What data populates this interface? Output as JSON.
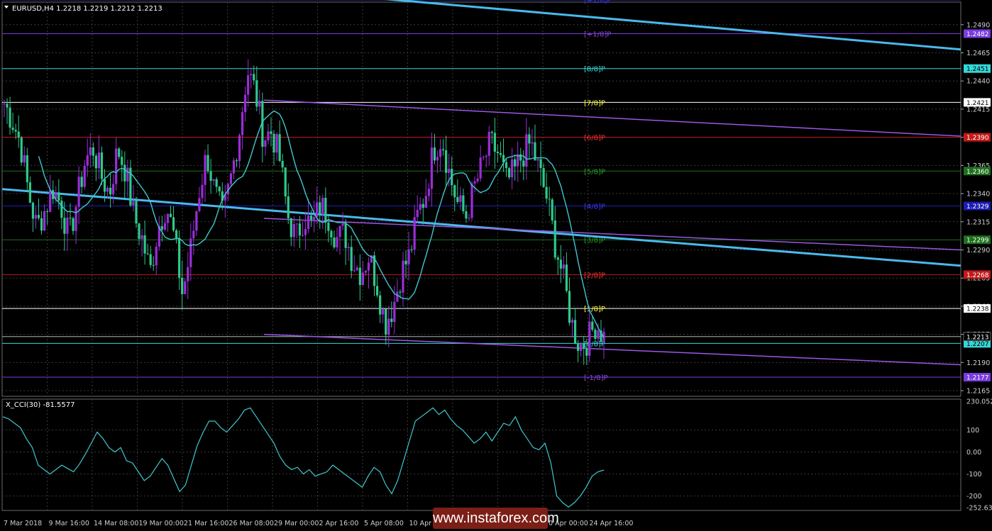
{
  "header": {
    "symbol_line": "EURUSD,H4  1.2218 1.2219 1.2212 1.2213"
  },
  "colors": {
    "bull": "#9a2dd8",
    "bear": "#2ec98a",
    "ma": "#40c7cf",
    "trend": "#4ab9ec",
    "channel": "#9b57e3",
    "grid": "#3a3a3a",
    "axis_text": "#cfcfcf"
  },
  "chart_data": [
    {
      "type": "candlestick",
      "title": "EURUSD,H4",
      "ohlc_readout": {
        "open": 1.2218,
        "high": 1.2219,
        "low": 1.2212,
        "close": 1.2213
      },
      "ylim": [
        1.216,
        1.251
      ],
      "y_ticks": [
        "1.2490",
        "1.2465",
        "1.2440",
        "1.2415",
        "1.2390",
        "1.2365",
        "1.2340",
        "1.2315",
        "1.2290",
        "1.2265",
        "1.2240",
        "1.2215",
        "1.2190",
        "1.2165"
      ],
      "x_ticks": [
        "7 Mar 2018",
        "9 Mar 16:00",
        "14 Mar 08:00",
        "19 Mar 00:00",
        "21 Mar 16:00",
        "26 Mar 08:00",
        "29 Mar 00:00",
        "2 Apr 16:00",
        "5 Apr 08:00",
        "10 Apr 00:00",
        "12 Apr 16:00",
        "17 Apr 08:00",
        "20 Apr 00:00",
        "24 Apr 16:00"
      ],
      "x_range": [
        "7 Mar 2018",
        "25 Apr 2018"
      ],
      "price_path": [
        1.242,
        1.2405,
        1.2385,
        1.234,
        1.231,
        1.2325,
        1.2345,
        1.233,
        1.23,
        1.2335,
        1.237,
        1.238,
        1.2355,
        1.234,
        1.238,
        1.236,
        1.232,
        1.23,
        1.227,
        1.231,
        1.233,
        1.23,
        1.225,
        1.229,
        1.234,
        1.2375,
        1.234,
        1.232,
        1.2355,
        1.2395,
        1.245,
        1.243,
        1.239,
        1.2395,
        1.237,
        1.232,
        1.23,
        1.232,
        1.231,
        1.233,
        1.232,
        1.23,
        1.2305,
        1.228,
        1.227,
        1.2285,
        1.226,
        1.2225,
        1.224,
        1.227,
        1.2285,
        1.232,
        1.234,
        1.238,
        1.239,
        1.2355,
        1.233,
        1.232,
        1.2345,
        1.2365,
        1.2385,
        1.2375,
        1.235,
        1.236,
        1.2375,
        1.2385,
        1.236,
        1.2335,
        1.2295,
        1.2265,
        1.2225,
        1.2205,
        1.221,
        1.2225,
        1.2213
      ],
      "levels": [
        {
          "label": "[+2/8]P",
          "value": 1.2512,
          "color": "#4040ff",
          "text_color": "#3030ff"
        },
        {
          "label": "[+1/8]P",
          "value": 1.2482,
          "color": "#7a3be0",
          "text_color": "#8a4ae8",
          "price_label": "1.2482"
        },
        {
          "label": "[8/8]P",
          "value": 1.2451,
          "color": "#35d7d7",
          "text_color": "#38e0e0",
          "price_label": "1.2451"
        },
        {
          "label": "[7/8]P",
          "value": 1.2421,
          "color": "#ffffff",
          "text_color": "#ffff33",
          "price_label": "1.2421"
        },
        {
          "label": "[6/8]P",
          "value": 1.239,
          "color": "#c21a1a",
          "text_color": "#ff3030",
          "price_label": "1.2390"
        },
        {
          "label": "[5/8]P",
          "value": 1.236,
          "color": "#1e6e1e",
          "text_color": "#2aa02a",
          "price_label": "1.2360"
        },
        {
          "label": "[4/8]P",
          "value": 1.2329,
          "color": "#1c1cb4",
          "text_color": "#3a3aff",
          "price_label": "1.2329"
        },
        {
          "label": "[3/8]P",
          "value": 1.2299,
          "color": "#1e6e1e",
          "text_color": "#2aa02a",
          "price_label": "1.2299"
        },
        {
          "label": "[2/8]P",
          "value": 1.2268,
          "color": "#c21a1a",
          "text_color": "#ff3030",
          "price_label": "1.2268"
        },
        {
          "label": "[1/8]P",
          "value": 1.2238,
          "color": "#ffffff",
          "text_color": "#ffff33",
          "price_label": "1.2238"
        },
        {
          "label": "[0/8]P",
          "value": 1.2207,
          "color": "#35d7d7",
          "text_color": "#38e0e0",
          "price_label": "1.2207"
        },
        {
          "label": "[-1/8]P",
          "value": 1.2177,
          "color": "#7a3be0",
          "text_color": "#8a4ae8",
          "price_label": "1.2177"
        }
      ],
      "current_price_label": "1.2213"
    },
    {
      "type": "line",
      "title": "X_CCI(30) -81.5577",
      "ylim": [
        -252.632,
        230.0522
      ],
      "y_ticks": [
        "230.0522",
        "100",
        "0.00",
        "-100",
        "-200",
        "-252.632"
      ],
      "values": [
        160,
        150,
        130,
        110,
        60,
        20,
        -60,
        -80,
        -100,
        -80,
        -60,
        -75,
        -90,
        -55,
        -10,
        40,
        90,
        60,
        20,
        0,
        20,
        -40,
        -50,
        -90,
        -130,
        -110,
        -70,
        -30,
        -60,
        -120,
        -180,
        -150,
        -60,
        30,
        90,
        140,
        140,
        110,
        90,
        120,
        150,
        190,
        200,
        160,
        120,
        80,
        40,
        -20,
        -60,
        -80,
        -70,
        -100,
        -80,
        -110,
        -100,
        -90,
        -60,
        -80,
        -100,
        -120,
        -140,
        -160,
        -110,
        -70,
        -90,
        -150,
        -190,
        -130,
        -40,
        50,
        140,
        160,
        180,
        200,
        170,
        190,
        150,
        120,
        100,
        70,
        40,
        60,
        90,
        50,
        90,
        130,
        120,
        160,
        100,
        60,
        20,
        10,
        40,
        -50,
        -200,
        -230,
        -250,
        -230,
        -200,
        -160,
        -110,
        -90,
        -82
      ]
    }
  ],
  "watermark": "www.instaforex.com"
}
